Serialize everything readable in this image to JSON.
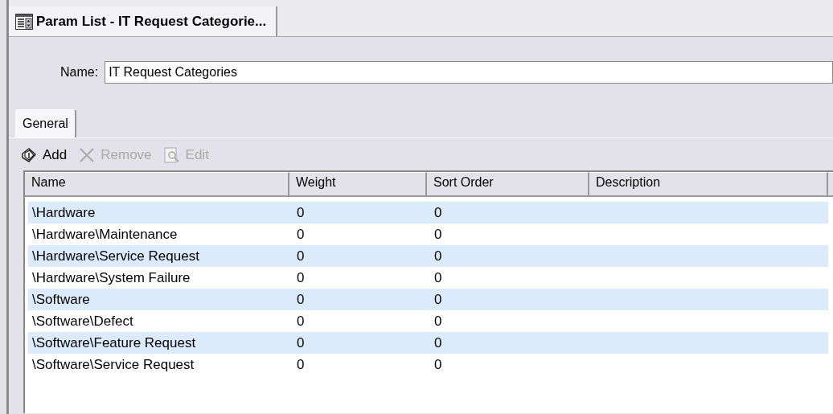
{
  "document_tab": {
    "title": "Param List - IT Request Categorie...",
    "selected": true
  },
  "name_field": {
    "label": "Name:",
    "value": "IT Request Categories"
  },
  "tabs": [
    {
      "label": "General",
      "selected": true
    }
  ],
  "toolbar": [
    {
      "kind": "add",
      "label": "Add",
      "disabled": false
    },
    {
      "kind": "remove",
      "label": "Remove",
      "disabled": true
    },
    {
      "kind": "edit",
      "label": "Edit",
      "disabled": true
    }
  ],
  "table": {
    "columns": [
      "Name",
      "Weight",
      "Sort Order",
      "Description"
    ],
    "rows": [
      {
        "cells": [
          "\\Hardware",
          "0",
          "0",
          ""
        ]
      },
      {
        "cells": [
          "\\Hardware\\Maintenance",
          "0",
          "0",
          ""
        ]
      },
      {
        "cells": [
          "\\Hardware\\Service Request",
          "0",
          "0",
          ""
        ]
      },
      {
        "cells": [
          "\\Hardware\\System Failure",
          "0",
          "0",
          ""
        ]
      },
      {
        "cells": [
          "\\Software",
          "0",
          "0",
          ""
        ]
      },
      {
        "cells": [
          "\\Software\\Defect",
          "0",
          "0",
          ""
        ]
      },
      {
        "cells": [
          "\\Software\\Feature Request",
          "0",
          "0",
          ""
        ]
      },
      {
        "cells": [
          "\\Software\\Service Request",
          "0",
          "0",
          ""
        ]
      }
    ]
  }
}
